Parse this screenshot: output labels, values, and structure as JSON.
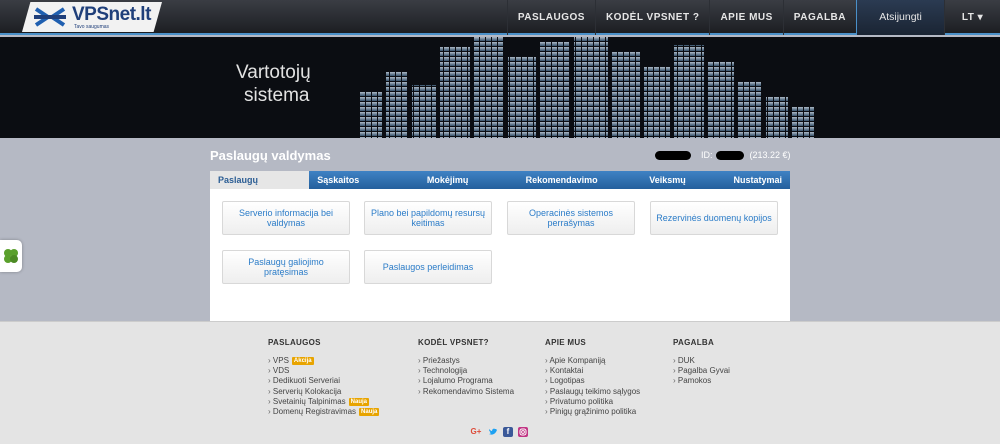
{
  "brand": {
    "name": "VPSnet.lt",
    "tagline": "Tavo saugumas"
  },
  "nav": {
    "items": [
      "PASLAUGOS",
      "KODĖL VPSNET ?",
      "APIE MUS",
      "PAGALBA"
    ],
    "login": "Atsijungti",
    "lang": "LT ▾"
  },
  "banner": {
    "line1": "Vartotojų",
    "line2": "sistema"
  },
  "main": {
    "title": "Paslaugų valdymas",
    "account_id_label": "ID:",
    "balance": "(213.22 €)"
  },
  "tabs": [
    "Paslaugų valdymas",
    "Sąskaitos papildymas",
    "Mokėjimų sistemos",
    "Rekomendavimo sistema",
    "Veiksmų istorija",
    "Nustatymai"
  ],
  "tiles": [
    "Serverio informacija bei valdymas",
    "Plano bei papildomų resursų keitimas",
    "Operacinės sistemos perrašymas",
    "Rezervinės duomenų kopijos",
    "Paslaugų galiojimo pratęsimas",
    "Paslaugos perleidimas"
  ],
  "footer": {
    "columns": [
      {
        "title": "PASLAUGOS",
        "links": [
          "VPS",
          "VDS",
          "Dedikuoti Serveriai",
          "Serverių Kolokacija",
          "Svetainių Talpinimas",
          "Domenų Registravimas"
        ],
        "badges": [
          "Akcija",
          "",
          "",
          "",
          "Nauja",
          "Nauja"
        ]
      },
      {
        "title": "KODĖL VPSNET?",
        "links": [
          "Priežastys",
          "Technologija",
          "Lojalumo Programa",
          "Rekomendavimo Sistema"
        ]
      },
      {
        "title": "APIE MUS",
        "links": [
          "Apie Kompaniją",
          "Kontaktai",
          "Logotipas",
          "Paslaugų teikimo sąlygos",
          "Privatumo politika",
          "Pinigų grąžinimo politika"
        ]
      },
      {
        "title": "PAGALBA",
        "links": [
          "DUK",
          "Pagalba Gyvai",
          "Pamokos"
        ]
      }
    ],
    "social": [
      "google-plus",
      "twitter",
      "facebook",
      "instagram"
    ]
  },
  "colors": {
    "accent": "#2b7cc8",
    "tab_bar": "#2f6fb0",
    "badge": "#e8a400",
    "background": "#b5b9c4"
  }
}
